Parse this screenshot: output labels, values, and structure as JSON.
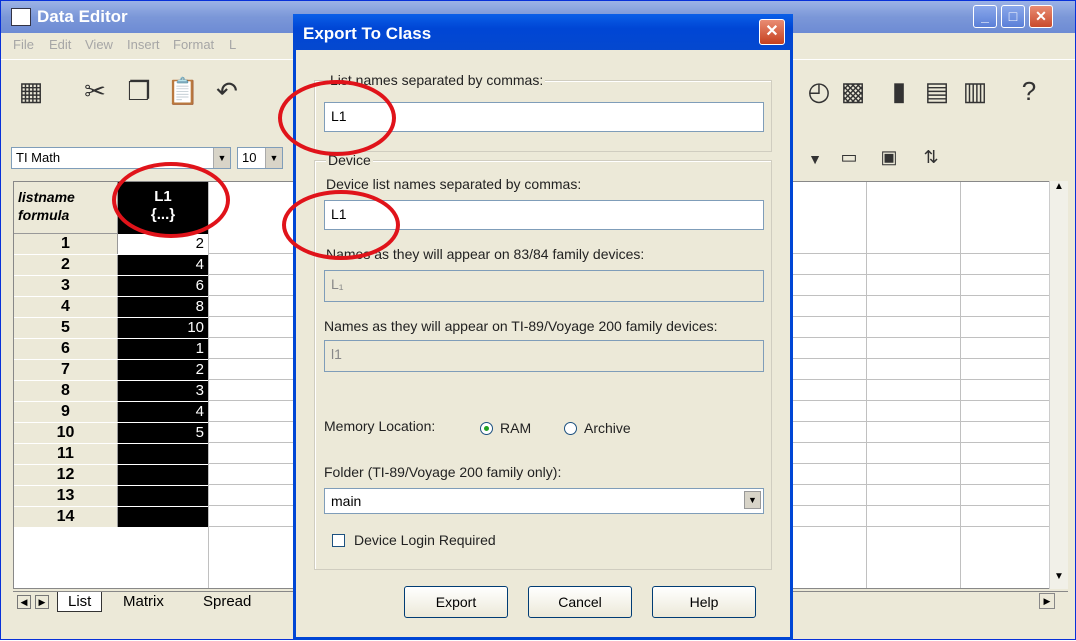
{
  "main_window": {
    "title": "Data Editor",
    "menu": [
      "File",
      "Edit",
      "View",
      "Insert",
      "Format",
      "L"
    ],
    "font_name": "TI Math",
    "font_size": "10",
    "grid": {
      "header_line1": "listname",
      "header_line2": "formula",
      "column_name": "L1",
      "column_sub": "{...}",
      "rows": [
        {
          "num": "1",
          "value": "2"
        },
        {
          "num": "2",
          "value": "4"
        },
        {
          "num": "3",
          "value": "6"
        },
        {
          "num": "4",
          "value": "8"
        },
        {
          "num": "5",
          "value": "10"
        },
        {
          "num": "6",
          "value": "1"
        },
        {
          "num": "7",
          "value": "2"
        },
        {
          "num": "8",
          "value": "3"
        },
        {
          "num": "9",
          "value": "4"
        },
        {
          "num": "10",
          "value": "5"
        },
        {
          "num": "11",
          "value": ""
        },
        {
          "num": "12",
          "value": ""
        },
        {
          "num": "13",
          "value": ""
        },
        {
          "num": "14",
          "value": ""
        }
      ]
    },
    "tabs": [
      "List",
      "Matrix",
      "Spread"
    ]
  },
  "dialog": {
    "title": "Export To Class",
    "list_names_label": "List names separated by commas:",
    "list_names_value": "L1",
    "device_group_label": "Device",
    "device_list_label": "Device list names separated by commas:",
    "device_list_value": "L1",
    "names_8384_label": "Names as they will appear on 83/84 family devices:",
    "names_8384_value": "L₁",
    "names_ti89_label": "Names as they will appear on TI-89/Voyage 200 family devices:",
    "names_ti89_value": "l1",
    "memory_label": "Memory Location:",
    "memory_ram": "RAM",
    "memory_archive": "Archive",
    "folder_label": "Folder (TI-89/Voyage 200 family only):",
    "folder_value": "main",
    "login_label": "Device Login Required",
    "export_button": "Export",
    "cancel_button": "Cancel",
    "help_button": "Help"
  }
}
